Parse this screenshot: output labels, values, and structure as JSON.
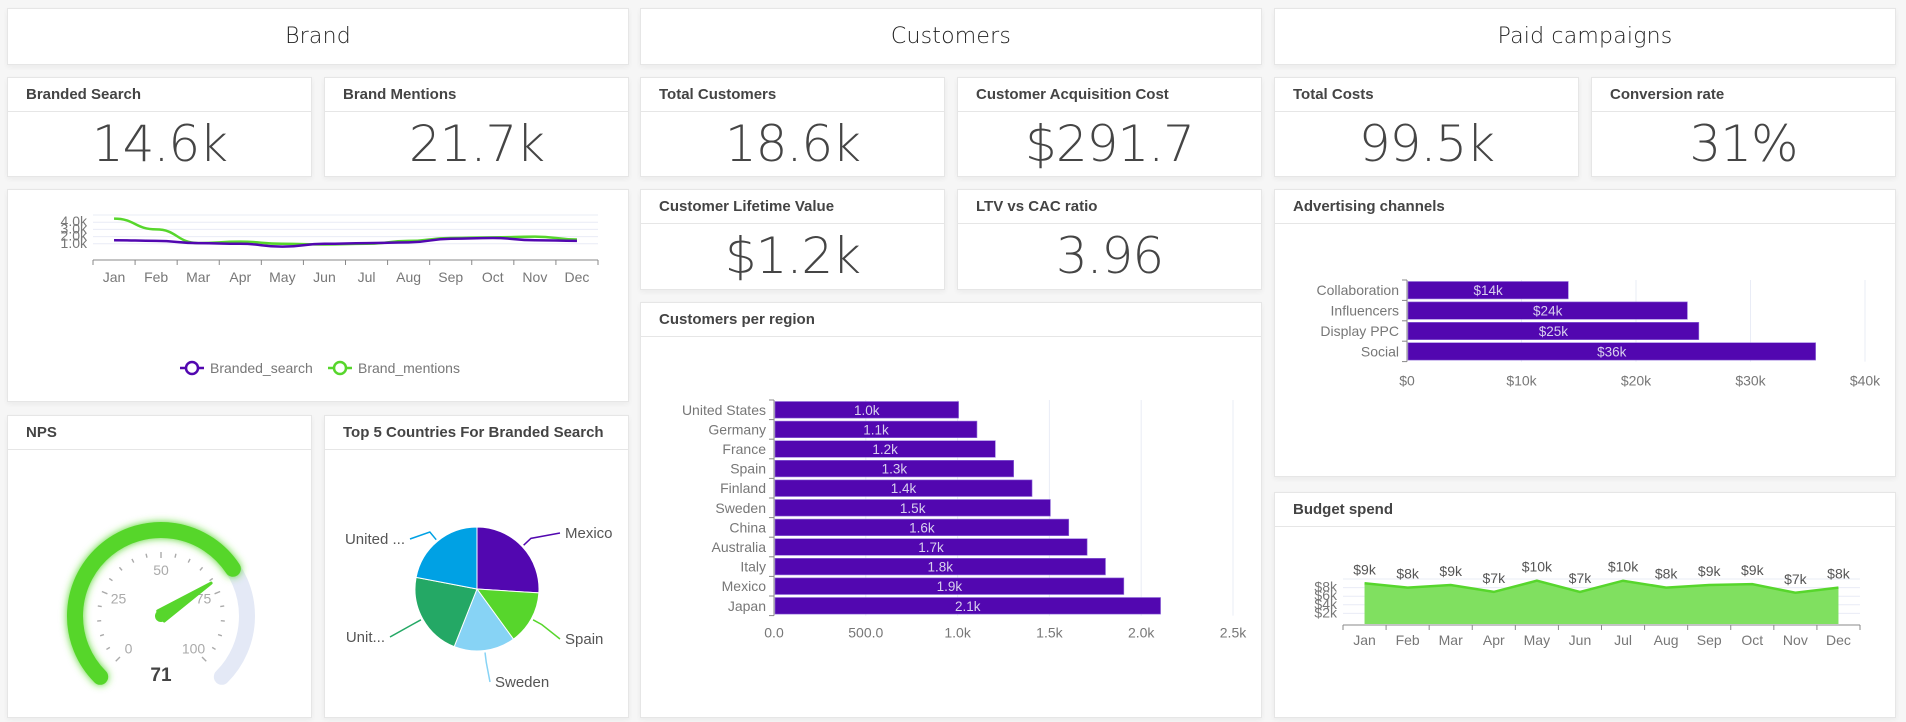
{
  "sections": {
    "brand": "Brand",
    "customers": "Customers",
    "paid": "Paid campaigns"
  },
  "kpis": {
    "branded_search": {
      "label": "Branded Search",
      "value": "14.6k"
    },
    "brand_mentions": {
      "label": "Brand Mentions",
      "value": "21.7k"
    },
    "total_customers": {
      "label": "Total Customers",
      "value": "18.6k"
    },
    "cac": {
      "label": "Customer Acquisition Cost",
      "value": "$291.7"
    },
    "clv": {
      "label": "Customer Lifetime Value",
      "value": "$1.2k"
    },
    "ltv_cac": {
      "label": "LTV vs CAC ratio",
      "value": "3.96"
    },
    "total_costs": {
      "label": "Total Costs",
      "value": "99.5k"
    },
    "conversion": {
      "label": "Conversion rate",
      "value": "31%"
    }
  },
  "cards": {
    "nps": "NPS",
    "top5": "Top 5 Countries For Branded Search",
    "region": "Customers per region",
    "adv": "Advertising channels",
    "budget": "Budget spend"
  },
  "colors": {
    "purple": "#5207b0",
    "green": "#57d62c",
    "gauge_track": "#e4e9f6",
    "budget_fill": "#80e060"
  },
  "chart_data": [
    {
      "id": "brand_trend",
      "type": "line",
      "title": "",
      "categories": [
        "Jan",
        "Feb",
        "Mar",
        "Apr",
        "May",
        "Jun",
        "Jul",
        "Aug",
        "Sep",
        "Oct",
        "Nov",
        "Dec"
      ],
      "series": [
        {
          "name": "Branded_search",
          "color": "#5207b0",
          "values": [
            1500,
            1400,
            1100,
            1000,
            600,
            1000,
            1100,
            1200,
            1700,
            1800,
            1500,
            1400
          ]
        },
        {
          "name": "Brand_mentions",
          "color": "#57d62c",
          "values": [
            4500,
            3000,
            1100,
            1300,
            1000,
            900,
            1000,
            1400,
            1800,
            1900,
            2000,
            1600
          ]
        }
      ],
      "yticks": [
        "1.0k",
        "2.0k",
        "3.0k",
        "4.0k"
      ],
      "ylim": [
        0,
        5000
      ],
      "grid": true,
      "legend": "bottom"
    },
    {
      "id": "nps_gauge",
      "type": "gauge",
      "value": 71,
      "range": [
        0,
        100
      ],
      "tick_labels": [
        "0",
        "25",
        "50",
        "75",
        "100"
      ]
    },
    {
      "id": "top5_pie",
      "type": "pie",
      "title": "Top 5 Countries For Branded Search",
      "labels": [
        "Mexico",
        "Spain",
        "Sweden",
        "Unit...",
        "United ..."
      ],
      "values": [
        26,
        14,
        16,
        22,
        22
      ],
      "colors": [
        "#5207b0",
        "#57d62c",
        "#87d3f5",
        "#24a865",
        "#00a1e4"
      ]
    },
    {
      "id": "customers_region",
      "type": "bar",
      "orientation": "horizontal",
      "title": "Customers per region",
      "categories": [
        "United States",
        "Germany",
        "France",
        "Spain",
        "Finland",
        "Sweden",
        "China",
        "Australia",
        "Italy",
        "Mexico",
        "Japan"
      ],
      "values": [
        1000,
        1100,
        1200,
        1300,
        1400,
        1500,
        1600,
        1700,
        1800,
        1900,
        2100
      ],
      "data_labels": [
        "1.0k",
        "1.1k",
        "1.2k",
        "1.3k",
        "1.4k",
        "1.5k",
        "1.6k",
        "1.7k",
        "1.8k",
        "1.9k",
        "2.1k"
      ],
      "xticks": [
        "0.0",
        "500.0",
        "1.0k",
        "1.5k",
        "2.0k",
        "2.5k"
      ],
      "xlim": [
        0,
        2500
      ],
      "grid": true
    },
    {
      "id": "adv_channels",
      "type": "bar",
      "orientation": "horizontal",
      "title": "Advertising channels",
      "categories": [
        "Collaboration",
        "Influencers",
        "Display PPC",
        "Social"
      ],
      "values": [
        14000,
        24400,
        25400,
        35600
      ],
      "data_labels": [
        "$14k",
        "$24k",
        "$25k",
        "$36k"
      ],
      "xticks": [
        "$0",
        "$10k",
        "$20k",
        "$30k",
        "$40k"
      ],
      "xlim": [
        0,
        40000
      ],
      "grid": true
    },
    {
      "id": "budget_spend",
      "type": "area",
      "title": "Budget spend",
      "categories": [
        "Jan",
        "Feb",
        "Mar",
        "Apr",
        "May",
        "Jun",
        "Jul",
        "Aug",
        "Sep",
        "Oct",
        "Nov",
        "Dec"
      ],
      "values": [
        9000,
        8000,
        8600,
        7000,
        9600,
        7000,
        9600,
        8000,
        8600,
        8800,
        6800,
        8000
      ],
      "data_labels": [
        "$9k",
        "$8k",
        "$9k",
        "$7k",
        "$10k",
        "$7k",
        "$10k",
        "$8k",
        "$9k",
        "$9k",
        "$7k",
        "$8k"
      ],
      "yticks": [
        "$2k",
        "$4k",
        "$6k",
        "$8k"
      ],
      "ylim": [
        0,
        10000
      ],
      "grid": true
    }
  ]
}
